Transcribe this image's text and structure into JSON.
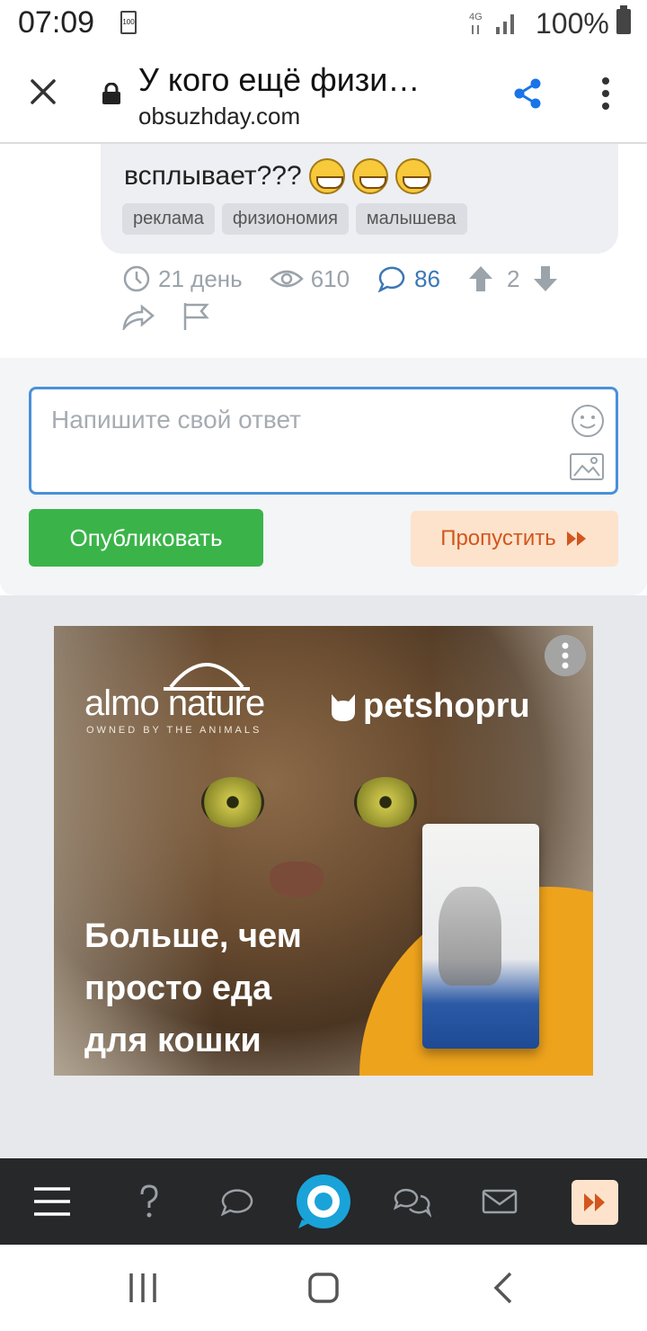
{
  "status_bar": {
    "time": "07:09",
    "battery_small": "100",
    "network": "4G",
    "battery_percent": "100%"
  },
  "browser": {
    "page_title": "У кого ещё физи…",
    "url": "obsuzhday.com",
    "icons": [
      "close-icon",
      "lock-icon",
      "share-icon",
      "more-vert-icon"
    ]
  },
  "post": {
    "text": "всплывает???",
    "tags": [
      "реклама",
      "физиономия",
      "малышева"
    ],
    "meta": {
      "age": "21 день",
      "views": "610",
      "comments": "86",
      "votes_up": "2"
    },
    "accent_color": "#3b77b5"
  },
  "reply": {
    "placeholder": "Напишите свой ответ",
    "publish_label": "Опубликовать",
    "skip_label": "Пропустить",
    "publish_color": "#3ab449",
    "skip_color": "#d2561d"
  },
  "ad": {
    "brand_left": "almo nature",
    "brand_left_tagline": "OWNED BY THE ANIMALS",
    "brand_right": "petshopru",
    "headline": [
      "Больше, чем",
      "просто еда",
      "для кошки"
    ]
  },
  "bottom_nav": {
    "items": [
      "menu-icon",
      "question-icon",
      "comment-icon",
      "live-icon",
      "chat-icon",
      "mail-icon",
      "skip-icon"
    ]
  },
  "system_nav": {
    "items": [
      "recents-icon",
      "home-icon",
      "back-icon"
    ]
  }
}
